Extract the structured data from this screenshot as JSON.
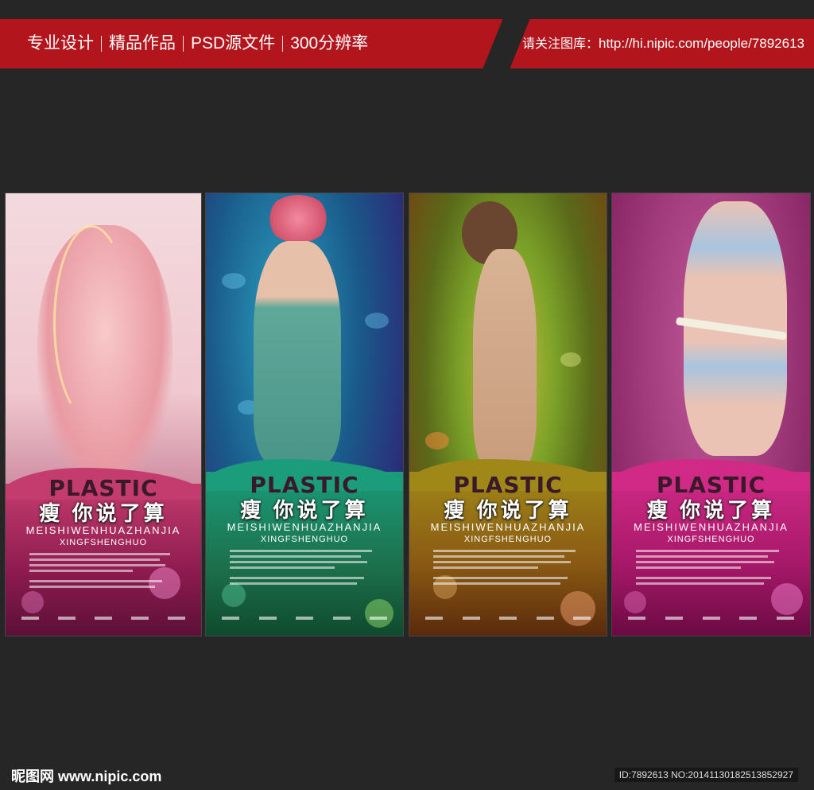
{
  "banner": {
    "items": [
      "专业设计",
      "精品作品",
      "PSD源文件",
      "300分辨率"
    ],
    "right_label": "请关注图库：",
    "right_url": "http://hi.nipic.com/people/7892613"
  },
  "posters": [
    {
      "title": "PLASTIC",
      "tagline": "瘦 你说了算",
      "sub1": "MEISHIWENHUAZHANJIA",
      "sub2": "XINGFSHENGHUO"
    },
    {
      "title": "PLASTIC",
      "tagline": "瘦 你说了算",
      "sub1": "MEISHIWENHUAZHANJIA",
      "sub2": "XINGFSHENGHUO"
    },
    {
      "title": "PLASTIC",
      "tagline": "瘦 你说了算",
      "sub1": "MEISHIWENHUAZHANJIA",
      "sub2": "XINGFSHENGHUO"
    },
    {
      "title": "PLASTIC",
      "tagline": "瘦 你说了算",
      "sub1": "MEISHIWENHUAZHANJIA",
      "sub2": "XINGFSHENGHUO"
    }
  ],
  "footer": {
    "logo": "昵图网 www.nipic.com",
    "id": "ID:7892613 NO:20141130182513852927"
  }
}
